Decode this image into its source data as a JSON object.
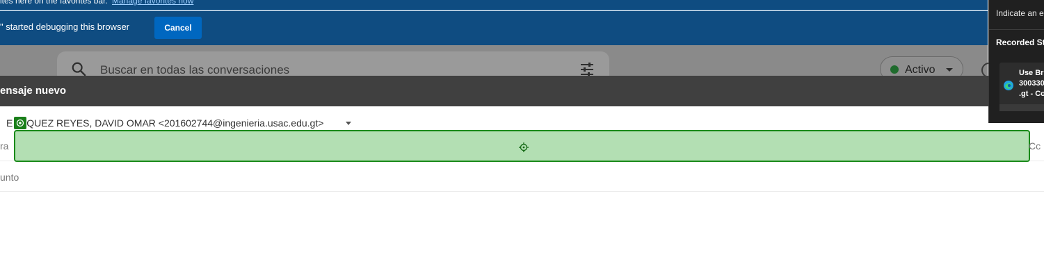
{
  "infobar": {
    "favorites_text": "ites here on the favorites bar.",
    "favorites_link": "Manage favorites now",
    "debug_message": "\" started debugging this browser",
    "cancel_label": "Cancel"
  },
  "header": {
    "search_placeholder": "Buscar en todas las conversaciones",
    "status_label": "Activo"
  },
  "compose": {
    "title": "ensaje nuevo",
    "from": "ENRIQUEZ REYES, DAVID OMAR <201602744@ingenieria.usac.edu.gt>",
    "from_visible_prefix": "E",
    "from_visible_rest": "IQUEZ REYES, DAVID OMAR <201602744@ingenieria.usac.edu.gt>",
    "to_label": "ra",
    "cc_label": "Cc",
    "subject_label": "unto"
  },
  "recorder": {
    "hint": "Indicate an el",
    "heading": "Recorded Ste",
    "step_line1": "Use Br",
    "step_line2": "300330",
    "step_line3": ".gt - Co"
  },
  "colors": {
    "infobar_bg": "#0f4c81",
    "cancel_bg": "#0067c0",
    "compose_title_bg": "#404040",
    "highlight_fill": "#b3dfb3",
    "highlight_border": "#1a8a1a",
    "status_dot": "#1f6b2d"
  }
}
